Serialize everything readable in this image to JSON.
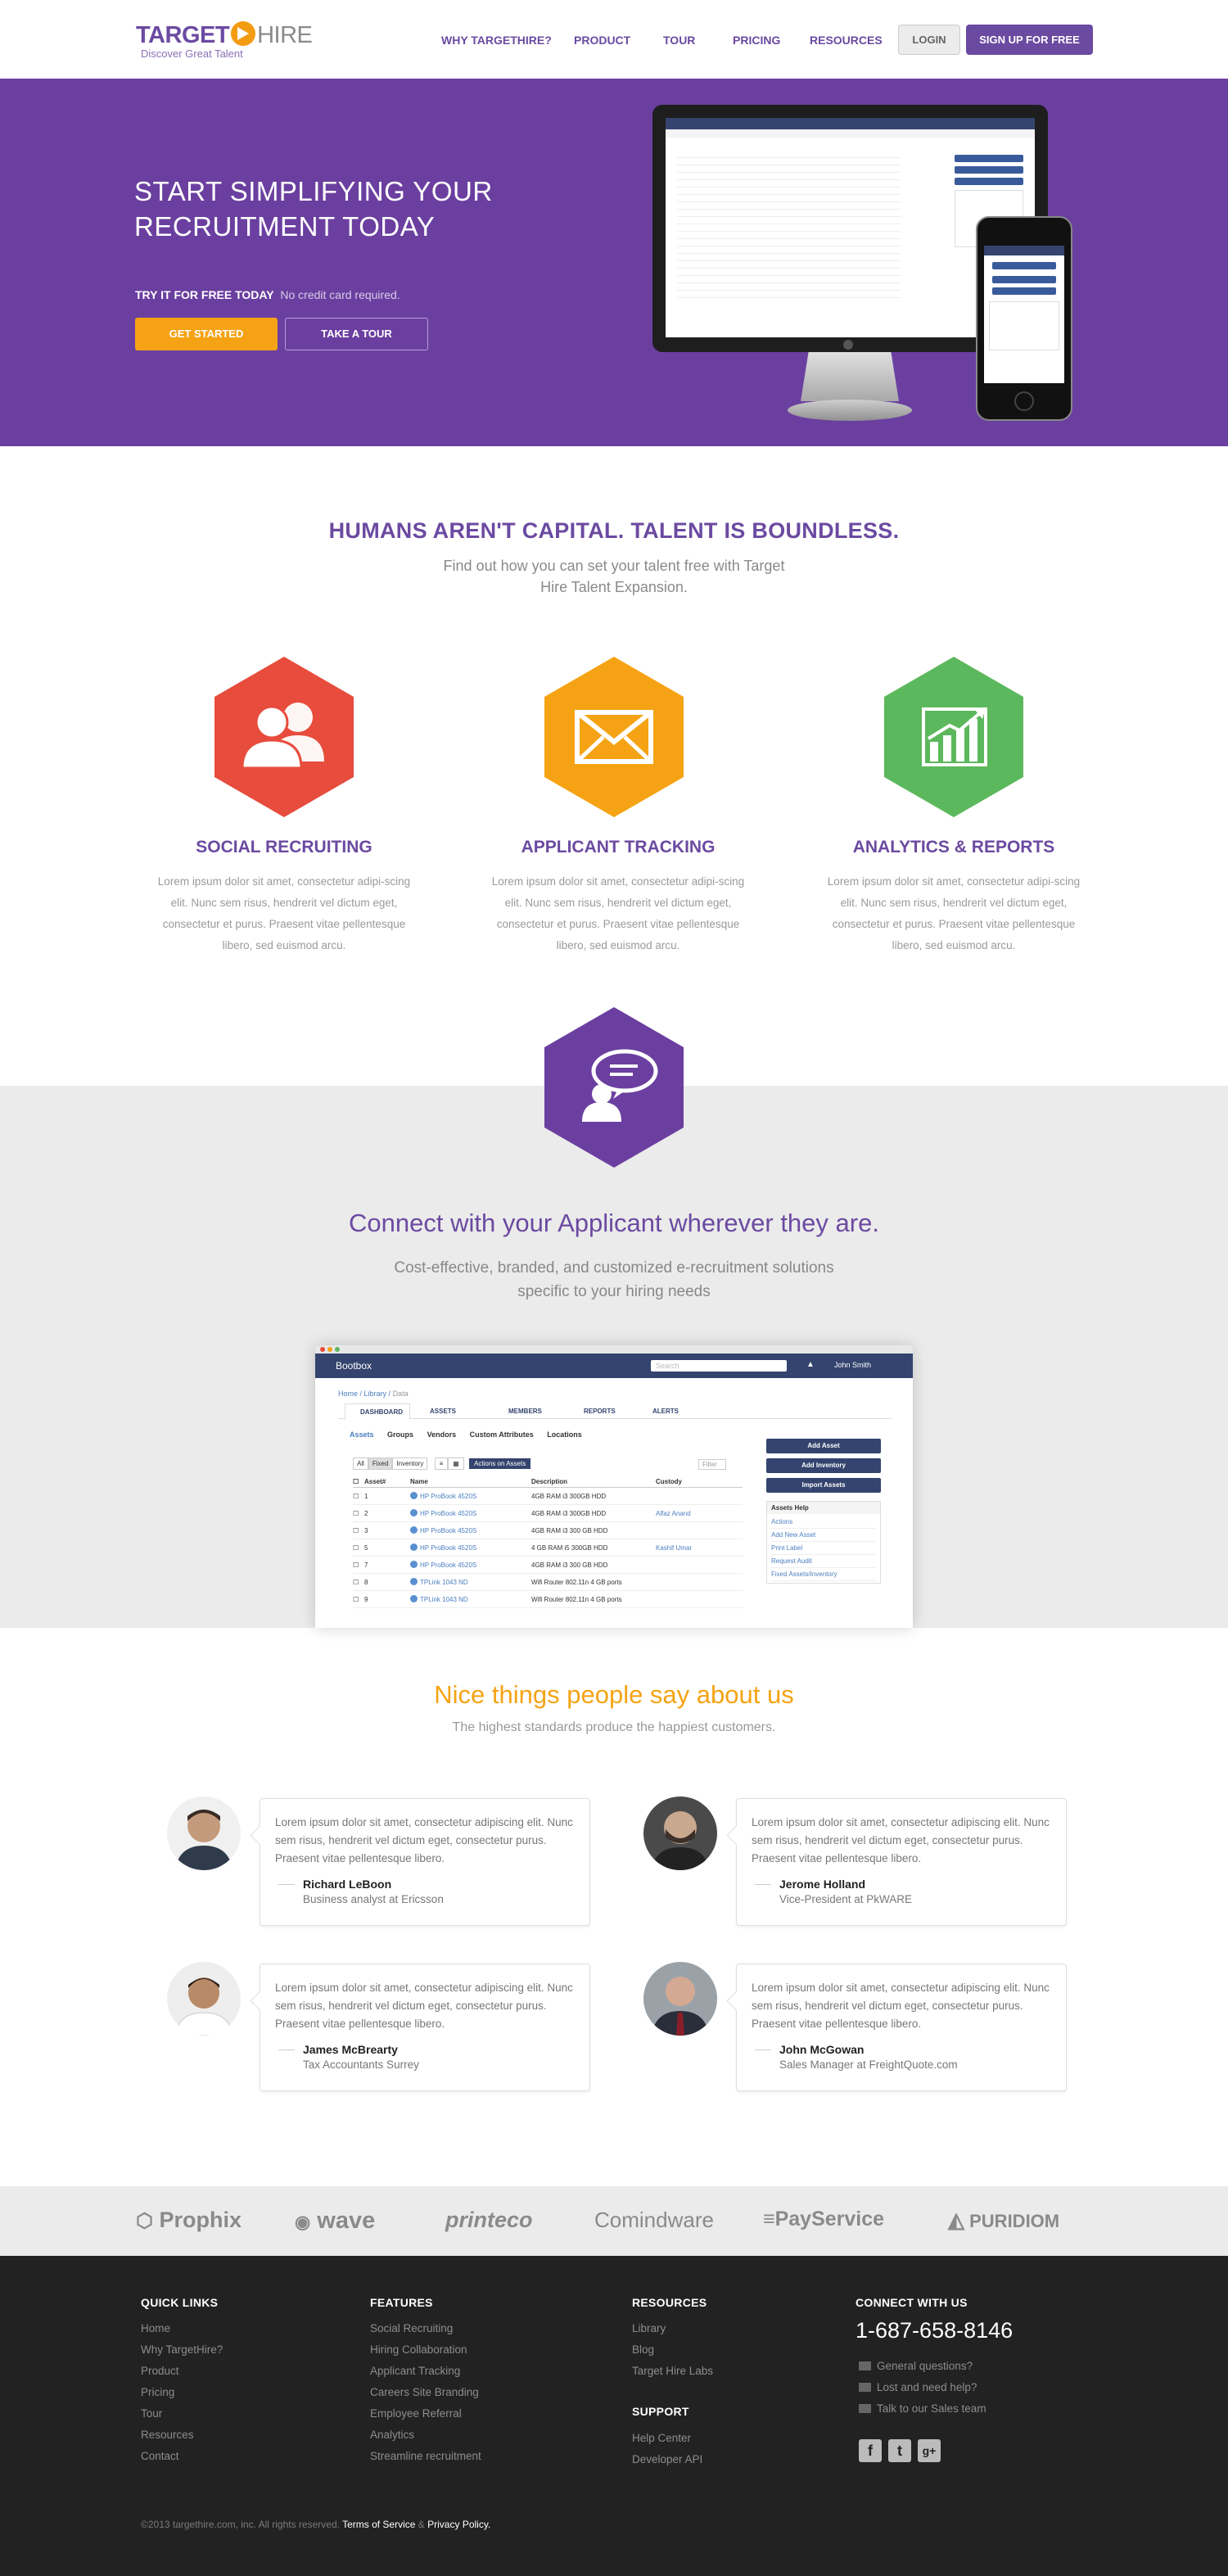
{
  "header": {
    "logo_target": "TARGET",
    "logo_hire": "HIRE",
    "tagline": "Discover Great Talent",
    "nav": [
      "WHY TARGETHIRE?",
      "PRODUCT",
      "TOUR",
      "PRICING",
      "RESOURCES"
    ],
    "login": "LOGIN",
    "signup": "SIGN UP FOR FREE"
  },
  "hero": {
    "title": "START SIMPLIFYING YOUR RECRUITMENT TODAY",
    "try_label": "TRY IT FOR FREE TODAY",
    "try_note": "No credit card required.",
    "btn_start": "GET STARTED",
    "btn_tour": "TAKE A TOUR"
  },
  "intro": {
    "title": "HUMANS AREN'T CAPITAL. TALENT IS BOUNDLESS.",
    "subtitle": "Find out how you can set your talent free with Target Hire Talent Expansion."
  },
  "features": [
    {
      "title": "SOCIAL RECRUITING",
      "text": "Lorem ipsum dolor sit amet, consectetur adipi-scing elit. Nunc sem risus, hendrerit vel dictum eget, consectetur et purus. Praesent vitae pellentesque libero, sed euismod arcu.",
      "icon": "users-icon",
      "color": "#e74c3c"
    },
    {
      "title": "APPLICANT TRACKING",
      "text": "Lorem ipsum dolor sit amet, consectetur adipi-scing elit. Nunc sem risus, hendrerit vel dictum eget, consectetur et purus. Praesent vitae pellentesque libero, sed euismod arcu.",
      "icon": "envelope-icon",
      "color": "#f5a314"
    },
    {
      "title": "ANALYTICS & REPORTS",
      "text": "Lorem ipsum dolor sit amet, consectetur adipi-scing elit. Nunc sem risus, hendrerit vel dictum eget, consectetur et purus. Praesent vitae pellentesque libero, sed euismod arcu.",
      "icon": "chart-icon",
      "color": "#5cb85c"
    }
  ],
  "connect": {
    "title": "Connect with your Applicant wherever they are.",
    "subtitle": "Cost-effective, branded, and customized e-recruitment solutions specific to your hiring needs"
  },
  "app": {
    "brand": "Bootbox",
    "search_placeholder": "Search",
    "user": "John Smith",
    "breadcrumb": [
      "Home",
      "Library",
      "Data"
    ],
    "tabs": [
      "DASHBOARD",
      "ASSETS",
      "MEMBERS",
      "REPORTS",
      "ALERTS"
    ],
    "subtabs": [
      "Assets",
      "Groups",
      "Vendors",
      "Custom Attributes",
      "Locations"
    ],
    "filters": [
      "All",
      "Fixed",
      "Inventory"
    ],
    "actions": "Actions on Assets",
    "filter_label": "Filter",
    "columns": [
      "Asset#",
      "Name",
      "Description",
      "Custody"
    ],
    "rows": [
      [
        "1",
        "HP ProBook 4520S",
        "4GB RAM i3 300GB HDD",
        ""
      ],
      [
        "2",
        "HP ProBook 4520S",
        "4GB RAM i3 300GB HDD",
        "Alfaz Anand"
      ],
      [
        "3",
        "HP ProBook 4520S",
        "4GB RAM i3 300 GB HDD",
        ""
      ],
      [
        "5",
        "HP ProBook 4520S",
        "4 GB RAM i5 300GB HDD",
        "Kashif Umar"
      ],
      [
        "7",
        "HP ProBook 4520S",
        "4GB RAM i3 300 GB HDD",
        ""
      ],
      [
        "8",
        "TPLink 1043 ND",
        "Wifi Router 802.11n 4 GB ports",
        ""
      ],
      [
        "9",
        "TPLink 1043 ND",
        "Wifi Router 802.11n 4 GB ports",
        ""
      ]
    ],
    "side_buttons": [
      "Add Asset",
      "Add Inventory",
      "Import Assets"
    ],
    "help_title": "Assets Help",
    "help_links": [
      "Actions",
      "Add New Asset",
      "Print Label",
      "Request Audit",
      "Fixed Assets/Inventory"
    ]
  },
  "testimonials": {
    "title": "Nice things people say about us",
    "subtitle": "The highest standards produce the happiest customers.",
    "items": [
      {
        "quote": "Lorem ipsum dolor sit amet, consectetur adipiscing elit. Nunc sem risus, hendrerit vel dictum eget, consectetur purus. Praesent vitae pellentesque libero.",
        "name": "Richard LeBoon",
        "role": "Business analyst at Ericsson"
      },
      {
        "quote": "Lorem ipsum dolor sit amet, consectetur adipiscing elit. Nunc sem risus, hendrerit vel dictum eget, consectetur purus. Praesent vitae pellentesque libero.",
        "name": "Jerome Holland",
        "role": "Vice-President at PkWARE"
      },
      {
        "quote": "Lorem ipsum dolor sit amet, consectetur adipiscing elit. Nunc sem risus, hendrerit vel dictum eget, consectetur purus. Praesent vitae pellentesque libero.",
        "name": "James McBrearty",
        "role": "Tax Accountants Surrey"
      },
      {
        "quote": "Lorem ipsum dolor sit amet, consectetur adipiscing elit. Nunc sem risus, hendrerit vel dictum eget, consectetur purus. Praesent vitae pellentesque libero.",
        "name": "John McGowan",
        "role": "Sales Manager at FreightQuote.com"
      }
    ]
  },
  "partners": [
    "Prophix",
    "wave",
    "printeco",
    "Comindware",
    "PayService",
    "PURIDIOM"
  ],
  "footer": {
    "quick_title": "QUICK LINKS",
    "quick": [
      "Home",
      "Why TargetHire?",
      "Product",
      "Pricing",
      "Tour",
      "Resources",
      "Contact"
    ],
    "features_title": "FEATURES",
    "features": [
      "Social Recruiting",
      "Hiring Collaboration",
      "Applicant Tracking",
      "Careers Site Branding",
      "Employee Referral",
      "Analytics",
      "Streamline recruitment"
    ],
    "resources_title": "RESOURCES",
    "resources": [
      "Library",
      "Blog",
      "Target Hire Labs"
    ],
    "support_title": "SUPPORT",
    "support": [
      "Help Center",
      "Developer API"
    ],
    "connect_title": "CONNECT WITH US",
    "phone": "1-687-658-8146",
    "contact": [
      "General questions?",
      "Lost and need help?",
      "Talk to our Sales team"
    ],
    "copyright": "©2013 targethire.com, inc. All rights reserved.",
    "terms": "Terms of Service",
    "amp": "&",
    "privacy": "Privacy Policy."
  }
}
